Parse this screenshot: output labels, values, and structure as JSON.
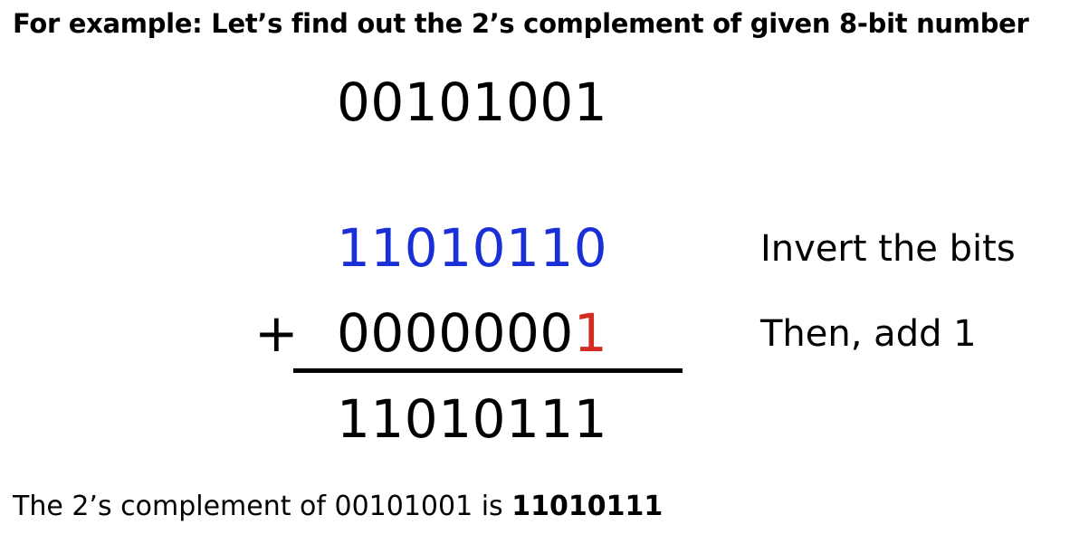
{
  "heading": "For example: Let’s find out the 2’s complement of given 8-bit number",
  "original_number": "00101001",
  "inverted_number": "11010110",
  "plus_sign": "+",
  "addend_prefix": "0000000",
  "addend_last_bit": "1",
  "result_number": "11010111",
  "steps": {
    "invert_label": "Invert the bits",
    "add_label": "Then, add 1"
  },
  "conclusion": {
    "prefix": "The 2’s complement of ",
    "number": "00101001",
    "is_word": " is ",
    "answer": "11010111"
  },
  "colors": {
    "inverted": "#1a2fd6",
    "added_bit": "#d42b20",
    "text": "#000000"
  }
}
